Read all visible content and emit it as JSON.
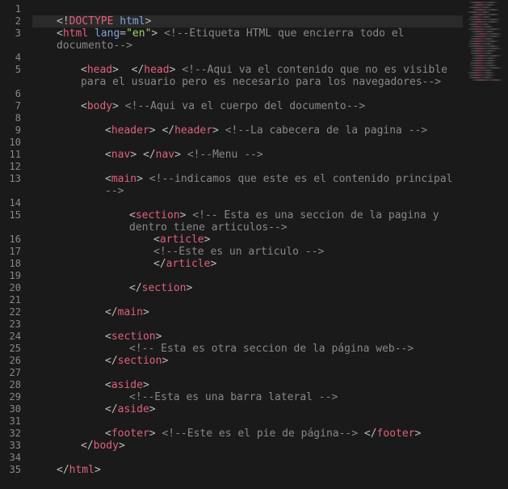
{
  "editor": {
    "lines": [
      {
        "n": 1,
        "indent": 0,
        "hl": false,
        "tokens": []
      },
      {
        "n": 2,
        "indent": 0,
        "hl": true,
        "tokens": [
          {
            "t": "punct",
            "v": "<!"
          },
          {
            "t": "tag-kw",
            "v": "DOCTYPE"
          },
          {
            "t": "text",
            "v": " "
          },
          {
            "t": "attrn",
            "v": "html"
          },
          {
            "t": "punct",
            "v": ">"
          }
        ]
      },
      {
        "n": 3,
        "indent": 0,
        "hl": false,
        "tokens": [
          {
            "t": "punct",
            "v": "<"
          },
          {
            "t": "tag-kw",
            "v": "html"
          },
          {
            "t": "text",
            "v": " "
          },
          {
            "t": "attrn",
            "v": "lang"
          },
          {
            "t": "punct",
            "v": "="
          },
          {
            "t": "attrv",
            "v": "\"en\""
          },
          {
            "t": "punct",
            "v": ">"
          },
          {
            "t": "text",
            "v": " "
          },
          {
            "t": "comment",
            "v": "<!--Etiqueta HTML que encierra todo el documento-->"
          }
        ]
      },
      {
        "n": 4,
        "indent": 0,
        "hl": false,
        "tokens": []
      },
      {
        "n": 5,
        "indent": 1,
        "hl": false,
        "tokens": [
          {
            "t": "punct",
            "v": "<"
          },
          {
            "t": "tag-kw",
            "v": "head"
          },
          {
            "t": "punct",
            "v": ">"
          },
          {
            "t": "text",
            "v": "  "
          },
          {
            "t": "punct",
            "v": "</"
          },
          {
            "t": "tag-kw",
            "v": "head"
          },
          {
            "t": "punct",
            "v": ">"
          },
          {
            "t": "text",
            "v": " "
          },
          {
            "t": "comment",
            "v": "<!--Aqui va el contenido que no es visible para el usuario pero es necesario para los navegadores-->"
          }
        ]
      },
      {
        "n": 6,
        "indent": 0,
        "hl": false,
        "tokens": []
      },
      {
        "n": 7,
        "indent": 1,
        "hl": false,
        "tokens": [
          {
            "t": "punct",
            "v": "<"
          },
          {
            "t": "tag-kw",
            "v": "body"
          },
          {
            "t": "punct",
            "v": ">"
          },
          {
            "t": "text",
            "v": " "
          },
          {
            "t": "comment",
            "v": "<!--Aqui va el cuerpo del documento-->"
          }
        ]
      },
      {
        "n": 8,
        "indent": 0,
        "hl": false,
        "tokens": []
      },
      {
        "n": 9,
        "indent": 2,
        "hl": false,
        "tokens": [
          {
            "t": "punct",
            "v": "<"
          },
          {
            "t": "tag-kw",
            "v": "header"
          },
          {
            "t": "punct",
            "v": ">"
          },
          {
            "t": "text",
            "v": " "
          },
          {
            "t": "punct",
            "v": "</"
          },
          {
            "t": "tag-kw",
            "v": "header"
          },
          {
            "t": "punct",
            "v": ">"
          },
          {
            "t": "text",
            "v": " "
          },
          {
            "t": "comment",
            "v": "<!--La cabecera de la pagina -->"
          }
        ]
      },
      {
        "n": 10,
        "indent": 0,
        "hl": false,
        "tokens": []
      },
      {
        "n": 11,
        "indent": 2,
        "hl": false,
        "tokens": [
          {
            "t": "punct",
            "v": "<"
          },
          {
            "t": "tag-kw",
            "v": "nav"
          },
          {
            "t": "punct",
            "v": ">"
          },
          {
            "t": "text",
            "v": " "
          },
          {
            "t": "punct",
            "v": "</"
          },
          {
            "t": "tag-kw",
            "v": "nav"
          },
          {
            "t": "punct",
            "v": ">"
          },
          {
            "t": "text",
            "v": " "
          },
          {
            "t": "comment",
            "v": "<!--Menu -->"
          }
        ]
      },
      {
        "n": 12,
        "indent": 0,
        "hl": false,
        "tokens": []
      },
      {
        "n": 13,
        "indent": 2,
        "hl": false,
        "tokens": [
          {
            "t": "punct",
            "v": "<"
          },
          {
            "t": "tag-kw",
            "v": "main"
          },
          {
            "t": "punct",
            "v": ">"
          },
          {
            "t": "text",
            "v": " "
          },
          {
            "t": "comment",
            "v": "<!--indicamos que este es el contenido principal -->"
          }
        ]
      },
      {
        "n": 14,
        "indent": 0,
        "hl": false,
        "tokens": []
      },
      {
        "n": 15,
        "indent": 3,
        "hl": false,
        "tokens": [
          {
            "t": "punct",
            "v": "<"
          },
          {
            "t": "tag-kw",
            "v": "section"
          },
          {
            "t": "punct",
            "v": ">"
          },
          {
            "t": "text",
            "v": " "
          },
          {
            "t": "comment",
            "v": "<!-- Esta es una seccion de la pagina y dentro tiene articulos-->"
          }
        ]
      },
      {
        "n": 16,
        "indent": 4,
        "hl": false,
        "tokens": [
          {
            "t": "punct",
            "v": "<"
          },
          {
            "t": "tag-kw",
            "v": "article"
          },
          {
            "t": "punct",
            "v": ">"
          }
        ]
      },
      {
        "n": 17,
        "indent": 4,
        "hl": false,
        "tokens": [
          {
            "t": "comment",
            "v": "<!--Este es un articulo -->"
          }
        ]
      },
      {
        "n": 18,
        "indent": 4,
        "hl": false,
        "tokens": [
          {
            "t": "punct",
            "v": "</"
          },
          {
            "t": "tag-kw",
            "v": "article"
          },
          {
            "t": "punct",
            "v": ">"
          }
        ]
      },
      {
        "n": 19,
        "indent": 0,
        "hl": false,
        "tokens": []
      },
      {
        "n": 20,
        "indent": 3,
        "hl": false,
        "tokens": [
          {
            "t": "punct",
            "v": "</"
          },
          {
            "t": "tag-kw",
            "v": "section"
          },
          {
            "t": "punct",
            "v": ">"
          }
        ]
      },
      {
        "n": 21,
        "indent": 0,
        "hl": false,
        "tokens": []
      },
      {
        "n": 22,
        "indent": 2,
        "hl": false,
        "tokens": [
          {
            "t": "punct",
            "v": "</"
          },
          {
            "t": "tag-kw",
            "v": "main"
          },
          {
            "t": "punct",
            "v": ">"
          }
        ]
      },
      {
        "n": 23,
        "indent": 0,
        "hl": false,
        "tokens": []
      },
      {
        "n": 24,
        "indent": 2,
        "hl": false,
        "tokens": [
          {
            "t": "punct",
            "v": "<"
          },
          {
            "t": "tag-kw",
            "v": "section"
          },
          {
            "t": "punct",
            "v": ">"
          }
        ]
      },
      {
        "n": 25,
        "indent": 3,
        "hl": false,
        "tokens": [
          {
            "t": "comment",
            "v": "<!-- Esta es otra seccion de la página web-->"
          }
        ]
      },
      {
        "n": 26,
        "indent": 2,
        "hl": false,
        "tokens": [
          {
            "t": "punct",
            "v": "</"
          },
          {
            "t": "tag-kw",
            "v": "section"
          },
          {
            "t": "punct",
            "v": ">"
          }
        ]
      },
      {
        "n": 27,
        "indent": 0,
        "hl": false,
        "tokens": []
      },
      {
        "n": 28,
        "indent": 2,
        "hl": false,
        "tokens": [
          {
            "t": "punct",
            "v": "<"
          },
          {
            "t": "tag-kw",
            "v": "aside"
          },
          {
            "t": "punct",
            "v": ">"
          }
        ]
      },
      {
        "n": 29,
        "indent": 3,
        "hl": false,
        "tokens": [
          {
            "t": "comment",
            "v": "<!--Esta es una barra lateral -->"
          }
        ]
      },
      {
        "n": 30,
        "indent": 2,
        "hl": false,
        "tokens": [
          {
            "t": "punct",
            "v": "</"
          },
          {
            "t": "tag-kw",
            "v": "aside"
          },
          {
            "t": "punct",
            "v": ">"
          }
        ]
      },
      {
        "n": 31,
        "indent": 0,
        "hl": false,
        "tokens": []
      },
      {
        "n": 32,
        "indent": 2,
        "hl": false,
        "tokens": [
          {
            "t": "punct",
            "v": "<"
          },
          {
            "t": "tag-kw",
            "v": "footer"
          },
          {
            "t": "punct",
            "v": ">"
          },
          {
            "t": "text",
            "v": " "
          },
          {
            "t": "comment",
            "v": "<!--Este es el pie de página-->"
          },
          {
            "t": "text",
            "v": " "
          },
          {
            "t": "punct",
            "v": "</"
          },
          {
            "t": "tag-kw",
            "v": "footer"
          },
          {
            "t": "punct",
            "v": ">"
          }
        ]
      },
      {
        "n": 33,
        "indent": 1,
        "hl": false,
        "tokens": [
          {
            "t": "punct",
            "v": "</"
          },
          {
            "t": "tag-kw",
            "v": "body"
          },
          {
            "t": "punct",
            "v": ">"
          }
        ]
      },
      {
        "n": 34,
        "indent": 0,
        "hl": false,
        "tokens": []
      },
      {
        "n": 35,
        "indent": 0,
        "hl": false,
        "tokens": [
          {
            "t": "punct",
            "v": "</"
          },
          {
            "t": "tag-kw",
            "v": "html"
          },
          {
            "t": "punct",
            "v": ">"
          }
        ]
      }
    ],
    "indent_size": 4,
    "base_indent": "    "
  }
}
